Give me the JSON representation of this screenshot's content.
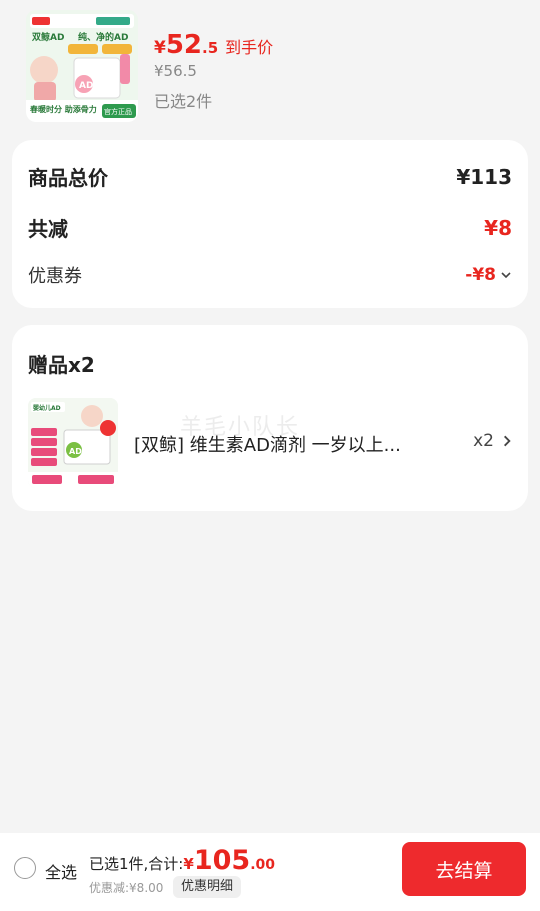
{
  "product": {
    "image_icon": "vitamin-ad-product-image",
    "price_int": "52",
    "price_dec": ".5",
    "currency": "¥",
    "price_tag": "到手价",
    "original_price": "¥56.5",
    "selected_count": "已选2件"
  },
  "summary": {
    "total_label": "商品总价",
    "total_value": "¥113",
    "reduce_label": "共减",
    "reduce_value": "¥8",
    "coupon_label": "优惠券",
    "coupon_value": "-¥8"
  },
  "gift": {
    "title": "赠品x2",
    "name": "[双鲸] 维生素AD滴剂 一岁以上...",
    "qty": "x2",
    "watermark": "羊毛小队长"
  },
  "bottom": {
    "select_all": "全选",
    "total_prefix": "已选1件,合计:",
    "currency": "¥",
    "total_int": "105",
    "total_dec": ".00",
    "discount_text": "优惠减:¥8.00",
    "detail_label": "优惠明细",
    "checkout_label": "去结算"
  },
  "colors": {
    "accent": "#e8261f",
    "checkout": "#ee2a2d",
    "background": "#f4f4f4"
  }
}
